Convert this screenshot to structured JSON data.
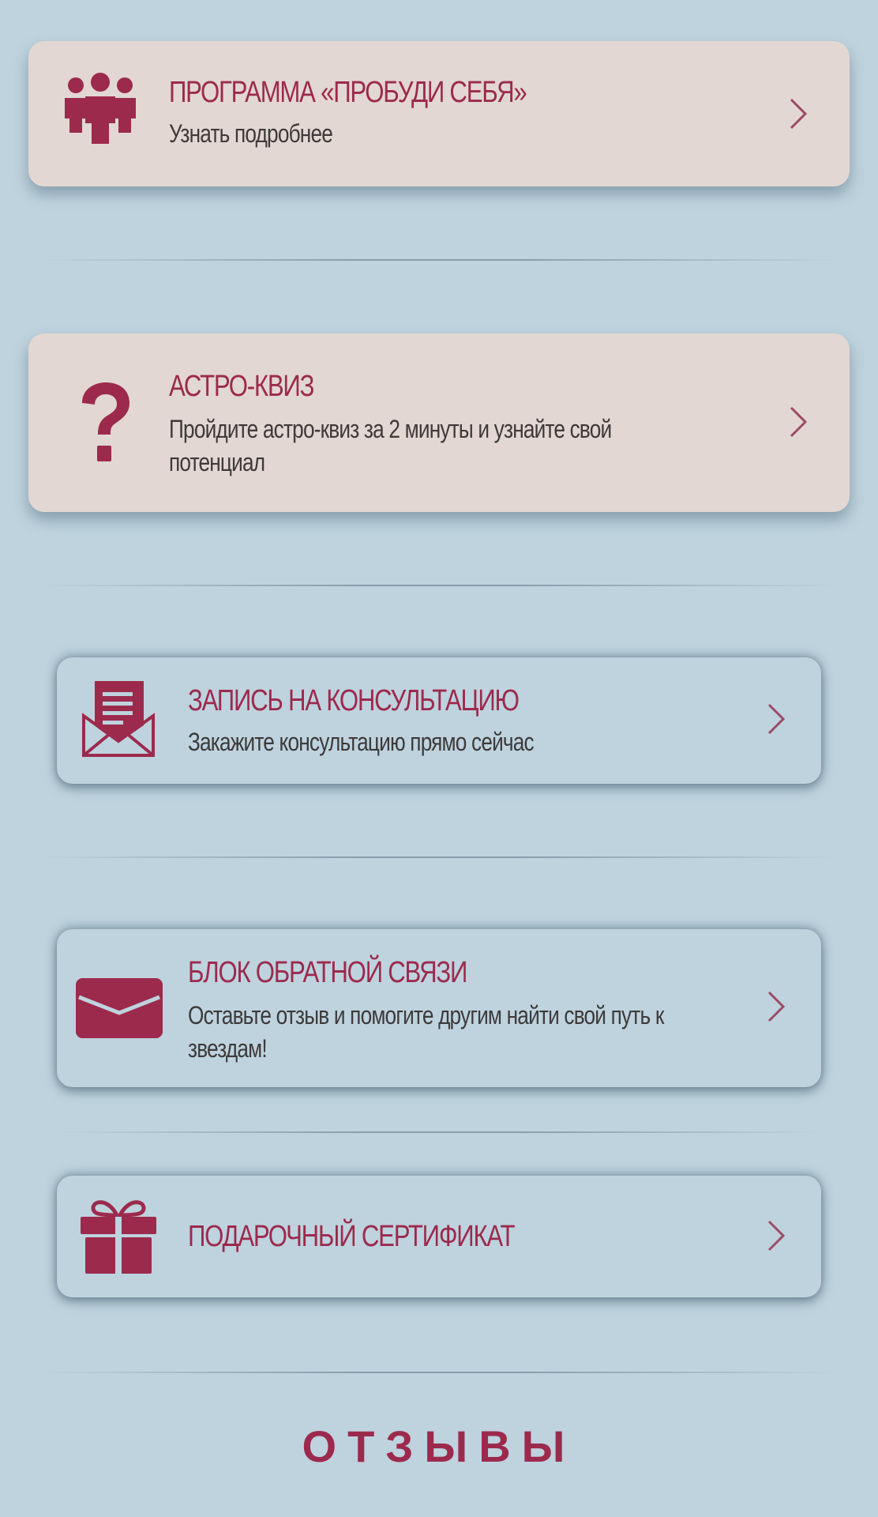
{
  "colors": {
    "background": "#bed3de",
    "card_beige": "#e2d7d2",
    "accent": "#9c2a4c",
    "text": "#3e3a3a"
  },
  "cards": [
    {
      "icon": "group-people-icon",
      "title": "ПРОГРАММА «ПРОБУДИ СЕБЯ»",
      "subtitle": "Узнать подробнее"
    },
    {
      "icon": "question-mark-icon",
      "title": "АСТРО-КВИЗ",
      "subtitle": "Пройдите астро-квиз за 2 минуты и узнайте свой потенциал"
    },
    {
      "icon": "envelope-letter-icon",
      "title": "ЗАПИСЬ НА КОНСУЛЬТАЦИЮ",
      "subtitle": "Закажите консультацию прямо сейчас"
    },
    {
      "icon": "envelope-icon",
      "title": "БЛОК ОБРАТНОЙ СВЯЗИ",
      "subtitle": "Оставьте отзыв и помогите другим найти свой путь к звездам!"
    },
    {
      "icon": "gift-icon",
      "title": "ПОДАРОЧНЫЙ СЕРТИФИКАТ"
    }
  ],
  "chevron_icon": "chevron-right-icon",
  "section_title": "ОТЗЫВЫ"
}
